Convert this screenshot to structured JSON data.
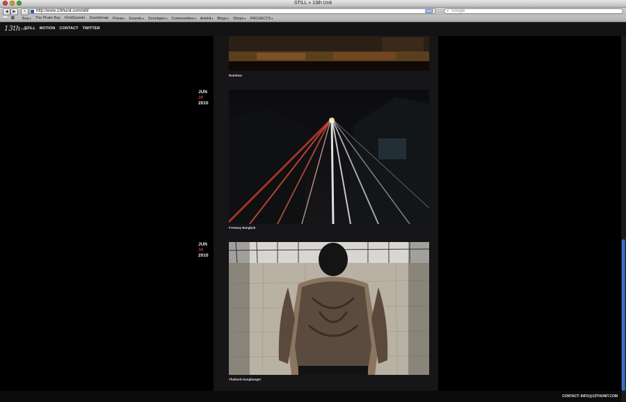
{
  "window": {
    "title": "STILL » 13th Unit"
  },
  "browser": {
    "url": "http://www.13thunit.com/still/",
    "rss_label": "RSS",
    "search_placeholder": "Google",
    "bookmarks": [
      {
        "label": "Buy",
        "menu": true
      },
      {
        "label": "The Pirate Bay",
        "menu": false
      },
      {
        "label": "FindSounds",
        "menu": false
      },
      {
        "label": "Soundsnap",
        "menu": false
      },
      {
        "label": "Privat",
        "menu": true
      },
      {
        "label": "Sounds",
        "menu": true
      },
      {
        "label": "Sonotigen",
        "menu": true
      },
      {
        "label": "Communities",
        "menu": true
      },
      {
        "label": "Artshit",
        "menu": true
      },
      {
        "label": "Blogs",
        "menu": true
      },
      {
        "label": "Shops",
        "menu": true
      },
      {
        "label": "PROJECTS",
        "menu": true
      }
    ]
  },
  "site": {
    "logo": "13th",
    "logo_sub": "UNIT",
    "nav": [
      "STILL",
      "MOTION",
      "CONTACT",
      "TWITTER"
    ],
    "contact": "CONTACT: INFO@13THUNIT.COM"
  },
  "posts": [
    {
      "caption": "Rainbow"
    },
    {
      "month": "JUN",
      "day": "30",
      "year": "2010",
      "caption": "Freeway Bangkok"
    },
    {
      "month": "JUN",
      "day": "30",
      "year": "2010",
      "caption": "Thailand Gangbanger"
    }
  ],
  "colors": {
    "accent_date": "#c9302c",
    "column_bg": "#161618",
    "scroll_thumb": "#3a6fc6"
  }
}
